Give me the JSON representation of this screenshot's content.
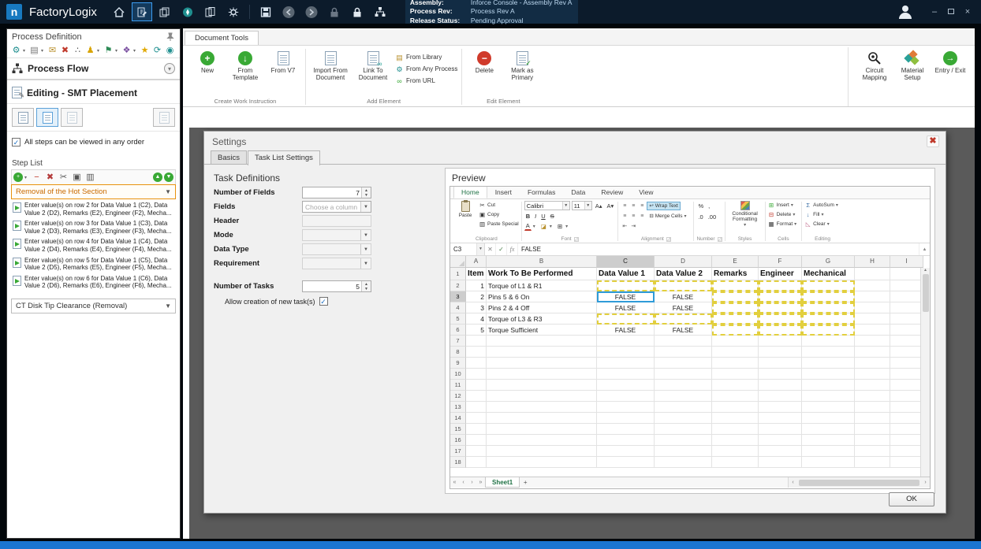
{
  "topbar": {
    "brand": "FactoryLogix",
    "logo_letter": "n",
    "info": [
      {
        "label": "Assembly:",
        "value": "Inforce Console - Assembly Rev A"
      },
      {
        "label": "Process Rev:",
        "value": "Process Rev A"
      },
      {
        "label": "Release Status:",
        "value": "Pending Approval"
      }
    ]
  },
  "left_panel": {
    "title": "Process Definition",
    "process_flow_label": "Process Flow",
    "editing_label": "Editing - SMT Placement",
    "order_checkbox_label": "All steps can be viewed in any order",
    "step_list_label": "Step List",
    "selected_step": "Removal of the Hot Section",
    "steps": [
      "Enter value(s) on row 2 for Data Value 1 (C2), Data Value 2 (D2), Remarks (E2), Engineer (F2), Mecha...",
      "Enter value(s) on row 3 for Data Value 1 (C3), Data Value 2 (D3), Remarks (E3), Engineer (F3), Mecha...",
      "Enter value(s) on row 4 for Data Value 1 (C4), Data Value 2 (D4), Remarks (E4), Engineer (F4), Mecha...",
      "Enter value(s) on row 5 for Data Value 1 (C5), Data Value 2 (D5), Remarks (E5), Engineer (F5), Mecha...",
      "Enter value(s) on row 6 for Data Value 1 (C6), Data Value 2 (D6), Remarks (E6), Engineer (F6), Mecha..."
    ],
    "footer_step": "CT Disk Tip Clearance (Removal)"
  },
  "doc_tools": {
    "tab_label": "Document Tools",
    "groups": [
      {
        "label": "Create Work Instruction",
        "buttons": [
          {
            "label": "New"
          },
          {
            "label": "From Template"
          },
          {
            "label": "From V7"
          }
        ]
      },
      {
        "label": "Add Element",
        "big_buttons": [
          "Import From Document",
          "Link To Document"
        ],
        "stacked_buttons": [
          "From Library",
          "From Any Process",
          "From URL"
        ]
      },
      {
        "label": "Edit Element",
        "buttons": [
          {
            "label": "Delete"
          },
          {
            "label": "Mark as Primary"
          }
        ]
      }
    ],
    "right_buttons": [
      "Circuit Mapping",
      "Material Setup",
      "Entry / Exit"
    ]
  },
  "settings_dialog": {
    "title": "Settings",
    "tabs": [
      "Basics",
      "Task List Settings"
    ],
    "section": "Task Definitions",
    "rows": [
      {
        "label": "Number of Fields",
        "value": "7"
      },
      {
        "label": "Fields",
        "value": "Choose a column"
      },
      {
        "label": "Header",
        "value": ""
      },
      {
        "label": "Mode",
        "value": ""
      },
      {
        "label": "Data Type",
        "value": ""
      },
      {
        "label": "Requirement",
        "value": ""
      },
      {
        "label": "Number of Tasks",
        "value": "5"
      }
    ],
    "allow_label": "Allow creation of new task(s)",
    "preview_label": "Preview",
    "ok_label": "OK"
  },
  "spreadsheet": {
    "ribbon_tabs": [
      "Home",
      "Insert",
      "Formulas",
      "Data",
      "Review",
      "View"
    ],
    "active_tab": "Home",
    "clipboard": {
      "paste": "Paste",
      "cut": "Cut",
      "copy": "Copy",
      "paste_special": "Paste Special",
      "group": "Clipboard"
    },
    "font": {
      "name": "Calibri",
      "size": "11",
      "buttons": [
        "B",
        "I",
        "U",
        "S"
      ],
      "group": "Font"
    },
    "alignment": {
      "wrap_text": "Wrap Text",
      "merge_cells": "Merge Cells",
      "group": "Alignment"
    },
    "number": {
      "icons": [
        "%",
        ",",
        ".0",
        ".00"
      ],
      "group": "Number"
    },
    "styles": {
      "conditional": "Conditional Formatting",
      "group": "Styles"
    },
    "cells": {
      "insert": "Insert",
      "delete": "Delete",
      "format": "Format",
      "group": "Cells"
    },
    "editing": {
      "autosum": "AutoSum",
      "fill": "Fill",
      "clear": "Clear",
      "group": "Editing"
    },
    "name_box": "C3",
    "formula": "FALSE",
    "columns": [
      "A",
      "B",
      "C",
      "D",
      "E",
      "F",
      "G",
      "H",
      "I"
    ],
    "header_row": [
      "Item",
      "Work To Be Performed",
      "Data Value 1",
      "Data Value 2",
      "Remarks",
      "Engineer",
      "Mechanical"
    ],
    "tasks": [
      {
        "item": "1",
        "name": "Torque of L1 & R1",
        "data1": "",
        "data2": ""
      },
      {
        "item": "2",
        "name": "Pins 5 & 6 On",
        "data1": "FALSE",
        "data2": "FALSE"
      },
      {
        "item": "3",
        "name": "Pins 2 & 4 Off",
        "data1": "FALSE",
        "data2": "FALSE"
      },
      {
        "item": "4",
        "name": "Torque of L3 & R3",
        "data1": "",
        "data2": ""
      },
      {
        "item": "5",
        "name": "Torque Sufficient",
        "data1": "FALSE",
        "data2": "FALSE"
      }
    ],
    "selected_cell": "C3",
    "dashed_cells": [
      "C2",
      "D2",
      "E2",
      "F2",
      "G2",
      "E3",
      "F3",
      "G3",
      "E4",
      "F4",
      "G4",
      "C5",
      "D5",
      "E5",
      "F5",
      "G5",
      "E6",
      "F6",
      "G6"
    ],
    "visible_rows": 18,
    "sheet_tab": "Sheet1",
    "new_sheet_label": "+"
  }
}
